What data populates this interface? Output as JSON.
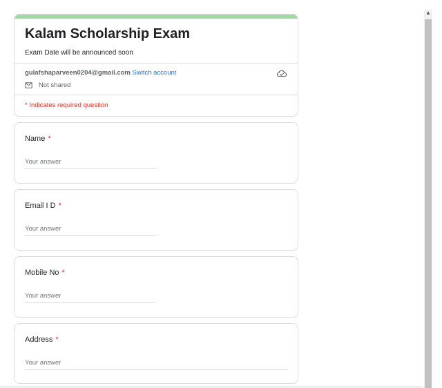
{
  "form": {
    "title": "Kalam Scholarship Exam",
    "description": "Exam Date will be announced soon",
    "account_email": "gulafshaparveen0204@gmail.com",
    "switch_account": "Switch account",
    "not_shared": "Not shared",
    "required_note": "* Indicates required question",
    "accent_color": "#a5d6a7"
  },
  "questions": [
    {
      "label": "Name",
      "required": "*",
      "placeholder": "Your answer"
    },
    {
      "label": "Email I D",
      "required": "*",
      "placeholder": "Your answer"
    },
    {
      "label": "Mobile No",
      "required": "*",
      "placeholder": "Your answer"
    },
    {
      "label": "Address",
      "required": "*",
      "placeholder": "Your answer"
    }
  ],
  "icons": {
    "cloud": "cloud-icon",
    "mail": "mail-icon",
    "scroll_up": "scroll-up-icon"
  }
}
